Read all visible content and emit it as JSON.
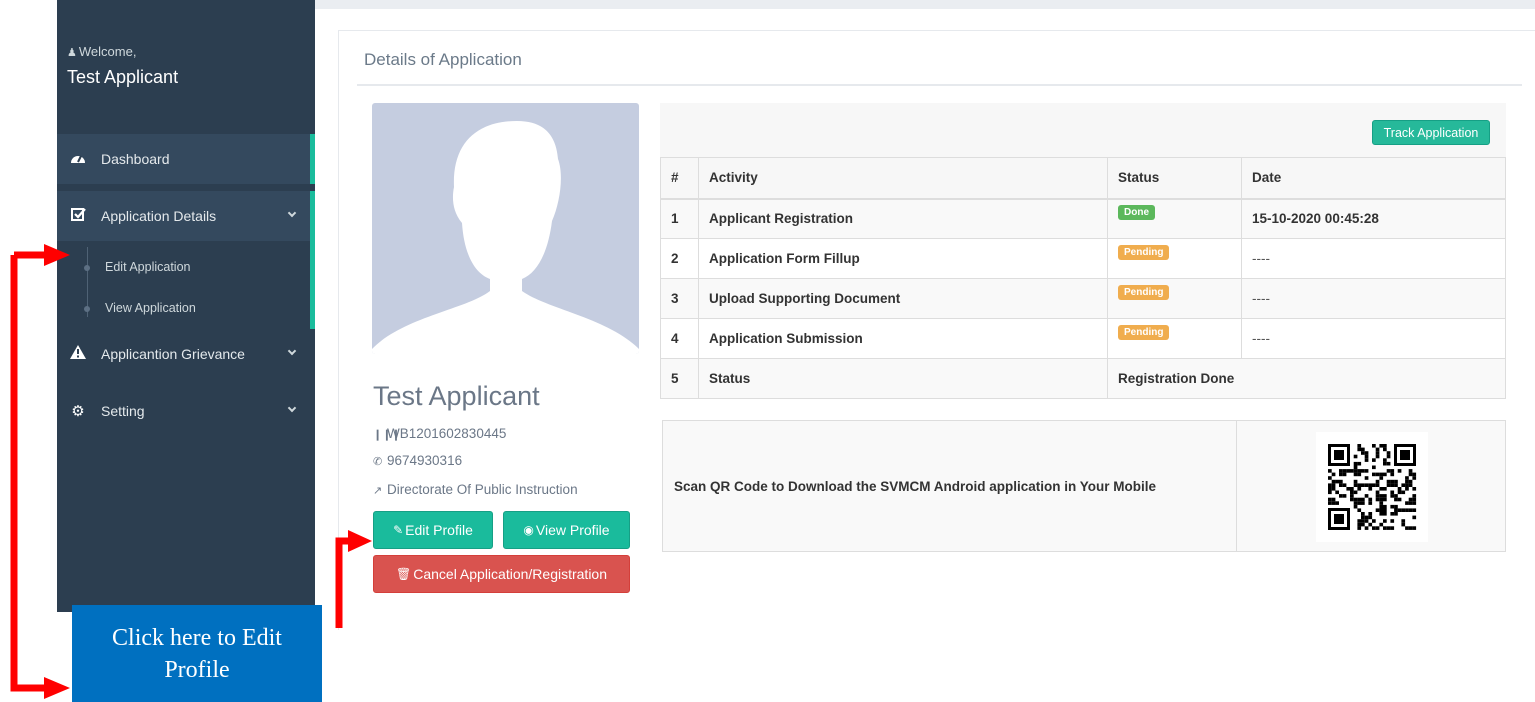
{
  "sidebar": {
    "welcome": "Welcome,",
    "user_name": "Test Applicant",
    "items": [
      {
        "label": "Dashboard",
        "icon": "dashboard-icon"
      },
      {
        "label": "Application Details",
        "icon": "check-square-icon"
      },
      {
        "label": "Applicantion Grievance",
        "icon": "warning-icon"
      },
      {
        "label": "Setting",
        "icon": "gear-icon"
      }
    ],
    "subitems": [
      {
        "label": "Edit Application"
      },
      {
        "label": "View Application"
      }
    ]
  },
  "main": {
    "title": "Details of Application"
  },
  "profile": {
    "name": "Test Applicant",
    "id": "WB1201602830445",
    "phone": "9674930316",
    "org": "Directorate Of Public Instruction",
    "edit_label": "Edit Profile",
    "view_label": "View Profile",
    "cancel_label": "Cancel Application/Registration"
  },
  "track_label": "Track Application",
  "table": {
    "headers": [
      "#",
      "Activity",
      "Status",
      "Date"
    ],
    "rows": [
      {
        "n": "1",
        "activity": "Applicant Registration",
        "status": "Done",
        "date": "15-10-2020 00:45:28"
      },
      {
        "n": "2",
        "activity": "Application Form Fillup",
        "status": "Pending",
        "date": "----"
      },
      {
        "n": "3",
        "activity": "Upload Supporting Document",
        "status": "Pending",
        "date": "----"
      },
      {
        "n": "4",
        "activity": "Application Submission",
        "status": "Pending",
        "date": "----"
      }
    ],
    "final": {
      "n": "5",
      "activity": "Status",
      "status": "Registration Done"
    }
  },
  "qr": {
    "text": "Scan QR Code to Download the SVMCM Android application in Your Mobile"
  },
  "annotation": {
    "callout": "Click here to Edit Profile"
  },
  "colors": {
    "sidebar": "#2c3e50",
    "accent": "#1abb9c",
    "danger": "#d9534f",
    "callout": "#0070c0",
    "arrow": "#ff0000"
  }
}
